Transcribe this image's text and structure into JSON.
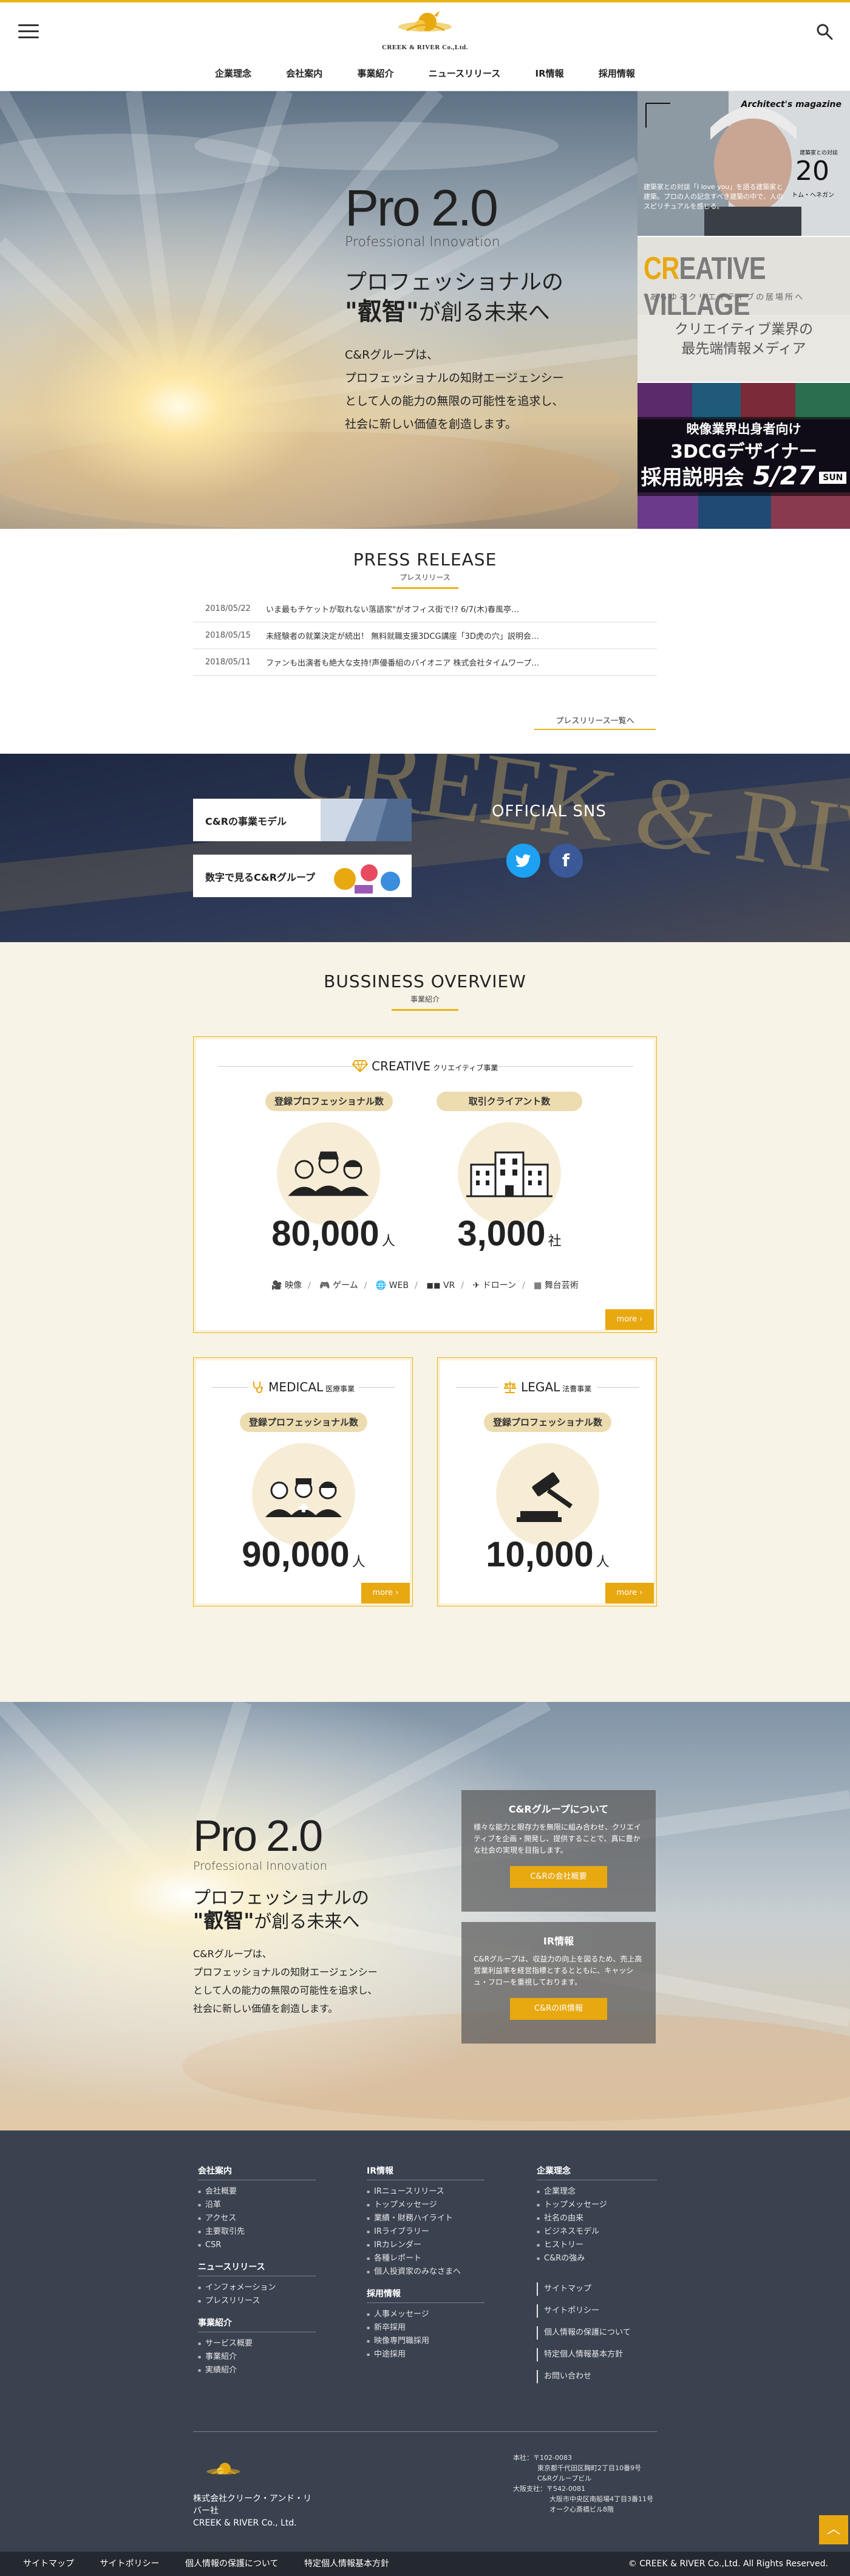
{
  "brand": {
    "logo_text": "CREEK & RIVER Co.,Ltd.",
    "accent": "#e8b416",
    "accent_dark": "#e8a810"
  },
  "nav": [
    "企業理念",
    "会社案内",
    "事業紹介",
    "ニュースリリース",
    "IR情報",
    "採用情報"
  ],
  "hero": {
    "pro": "Pro 2.0",
    "pro_sub": "Professional Innovation",
    "catch1": "プロフェッショナルの",
    "catch2a": "\"叡智\"",
    "catch2b": "が創る未来へ",
    "lead1": "C&Rグループは、",
    "lead2": "プロフェッショナルの知財エージェンシー",
    "lead3": "として人の能力の無限の可能性を追求し、",
    "lead4": "社会に新しい価値を創造します。"
  },
  "side": {
    "arch_title": "Architect's magazine",
    "arch_lbl": "建築家との対談",
    "arch_num": "20",
    "arch_name": "トム・ヘネガン",
    "arch_text": "建築家との対談「I love you」を語る建築家と建築。プロの人の記念すべき建築の中で、人のスピリチュアルを感じる。",
    "cv_title_a": "CR",
    "cv_title_b": "EATIVE VILLAGE",
    "cv_sub": "あらゆるクリエイティブの居場所へ",
    "cv_band1": "クリエイティブ業界の",
    "cv_band2": "最先端情報メディア",
    "rc1": "映像業界出身者向け",
    "rc2": "3DCGデザイナー",
    "rc3": "採用説明会",
    "rc_date": "5/27",
    "rc_day": "SUN"
  },
  "press": {
    "title": "PRESS RELEASE",
    "sub": "プレスリリース",
    "items": [
      {
        "date": "2018/05/22",
        "text": "いま最もチケットが取れない落語家\"がオフィス街で!? 6/7(木)春風亭…"
      },
      {
        "date": "2018/05/15",
        "text": "未経験者の就業決定が続出！ 無料就職支援3DCG講座「3D虎の穴」説明会…"
      },
      {
        "date": "2018/05/11",
        "text": "ファンも出演者も絶大な支持!声優番組のパイオニア 株式会社タイムワープ…"
      }
    ],
    "more": "プレスリリース一覧へ"
  },
  "band": {
    "btn1": "C&Rの事業モデル",
    "btn2": "数字で見るC&Rグループ",
    "sns_title": "OFFICIAL SNS",
    "bg_text": "CREEK & RIVER Co.,Ltd."
  },
  "overview": {
    "title": "BUSSINESS OVERVIEW",
    "sub": "事業紹介",
    "creative": {
      "name": "CREATIVE",
      "name_jp": "クリエイティブ事業",
      "pill1": "登録プロフェッショナル数",
      "num1": "80,000",
      "unit1": "人",
      "pill2": "取引クライアント数",
      "num2": "3,000",
      "unit2": "社",
      "cats": [
        "映像",
        "ゲーム",
        "WEB",
        "VR",
        "ドローン",
        "舞台芸術"
      ],
      "more": "more"
    },
    "medical": {
      "name": "MEDICAL",
      "name_jp": "医療事業",
      "pill": "登録プロフェッショナル数",
      "num": "90,000",
      "unit": "人",
      "more": "more"
    },
    "legal": {
      "name": "LEGAL",
      "name_jp": "法曹事業",
      "pill": "登録プロフェッショナル数",
      "num": "10,000",
      "unit": "人",
      "more": "more"
    }
  },
  "hero2": {
    "pro": "Pro 2.0",
    "pro_sub": "Professional Innovation",
    "catch1": "プロフェッショナルの",
    "catch2a": "\"叡智\"",
    "catch2b": "が創る未来へ",
    "lead1": "C&Rグループは、",
    "lead2": "プロフェッショナルの知財エージェンシー",
    "lead3": "として人の能力の無限の可能性を追求し、",
    "lead4": "社会に新しい価値を創造します。",
    "box1_title": "C&Rグループについて",
    "box1_text": "様々な能力と眼存力を無限に組み合わせ、クリエイティブを企画・開発し、提供することで、真に豊かな社会の実現を目指します。",
    "box1_btn": "C&Rの会社概要",
    "box2_title": "IR情報",
    "box2_text": "C&Rグループは、収益力の向上を図るため、売上高営業利益率を経営指標とするとともに、キャッシュ・フローを重視しております。",
    "box2_btn": "C&RのIR情報"
  },
  "footer": {
    "col1": [
      {
        "h": "会社案内",
        "items": [
          "会社概要",
          "沿革",
          "アクセス",
          "主要取引先",
          "CSR"
        ]
      },
      {
        "h": "ニュースリリース",
        "items": [
          "インフォメーション",
          "プレスリリース"
        ]
      },
      {
        "h": "事業紹介",
        "items": [
          "サービス概要",
          "事業紹介",
          "実績紹介"
        ]
      }
    ],
    "col2": [
      {
        "h": "IR情報",
        "items": [
          "IRニュースリリース",
          "トップメッセージ",
          "業績・財務ハイライト",
          "IRライブラリー",
          "IRカレンダー",
          "各種レポート",
          "個人投資家のみなさまへ"
        ]
      },
      {
        "h": "採用情報",
        "items": [
          "人事メッセージ",
          "新卒採用",
          "映像専門職採用",
          "中途採用"
        ]
      }
    ],
    "col3": [
      {
        "h": "企業理念",
        "items": [
          "企業理念",
          "トップメッセージ",
          "社名の由来",
          "ビジネスモデル",
          "ヒストリー",
          "C&Rの強み"
        ]
      }
    ],
    "col3_links": [
      "サイトマップ",
      "サイトポリシー",
      "個人情報の保護について",
      "特定個人情報基本方針",
      "お問い合わせ"
    ],
    "company": "株式会社クリーク・アンド・リバー社",
    "company_en": "CREEK & RIVER Co., Ltd.",
    "addr": [
      "本社：〒102-0083",
      "東京都千代田区麹町2丁目10番9号",
      "C&Rグループビル",
      "大阪支社：〒542-0081",
      "大阪市中央区南船場4丁目3番11号",
      "オーク心斎橋ビル8階"
    ],
    "bottom_links": [
      "サイトマップ",
      "サイトポリシー",
      "個人情報の保護について",
      "特定個人情報基本方針"
    ],
    "copyright": "© CREEK & RIVER Co.,Ltd. All Rights Reserved."
  }
}
